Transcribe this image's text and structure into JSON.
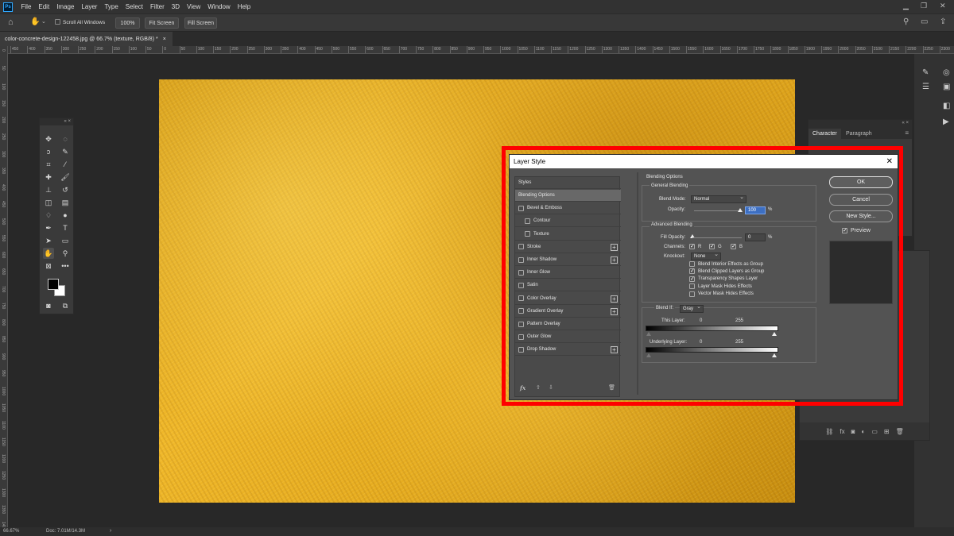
{
  "menubar": {
    "logo": "Ps",
    "items": [
      "File",
      "Edit",
      "Image",
      "Layer",
      "Type",
      "Select",
      "Filter",
      "3D",
      "View",
      "Window",
      "Help"
    ]
  },
  "options": {
    "scroll_all": "Scroll All Windows",
    "zoom": "100%",
    "fit": "Fit Screen",
    "fill": "Fill Screen"
  },
  "document": {
    "tab_title": "color-concrete-design-122458.jpg @ 66.7% (texture, RGB/8) *"
  },
  "ruler": {
    "top": [
      "450",
      "400",
      "350",
      "300",
      "250",
      "200",
      "150",
      "100",
      "50",
      "0",
      "50",
      "100",
      "150",
      "200",
      "250",
      "300",
      "350",
      "400",
      "450",
      "500",
      "550",
      "600",
      "650",
      "700",
      "750",
      "800",
      "850",
      "900",
      "950",
      "1000",
      "1050",
      "1100",
      "1150",
      "1200",
      "1250",
      "1300",
      "1350",
      "1400",
      "1450",
      "1500",
      "1550",
      "1600",
      "1650",
      "1700",
      "1750",
      "1800",
      "1850",
      "1900",
      "1950",
      "2000",
      "2050",
      "2100",
      "2150",
      "2200",
      "2250",
      "2300",
      "235"
    ],
    "left": [
      "0",
      "50",
      "100",
      "150",
      "200",
      "250",
      "300",
      "350",
      "400",
      "450",
      "500",
      "550",
      "600",
      "650",
      "700",
      "750",
      "800",
      "850",
      "900",
      "950",
      "1000",
      "1050",
      "1100",
      "1150",
      "1200",
      "1250",
      "1300",
      "1350",
      "1400"
    ]
  },
  "panels": {
    "character_tab": "Character",
    "paragraph_tab": "Paragraph"
  },
  "status": {
    "zoom": "66.67%",
    "doc": "Doc: 7.01M/14.3M"
  },
  "dialog": {
    "title": "Layer Style",
    "styles_header": "Styles",
    "styles": [
      {
        "label": "Blending Options",
        "checkbox": false,
        "plus": false,
        "indent": false,
        "selected": true
      },
      {
        "label": "Bevel & Emboss",
        "checkbox": true,
        "plus": false,
        "indent": false
      },
      {
        "label": "Contour",
        "checkbox": true,
        "plus": false,
        "indent": true
      },
      {
        "label": "Texture",
        "checkbox": true,
        "plus": false,
        "indent": true
      },
      {
        "label": "Stroke",
        "checkbox": true,
        "plus": true,
        "indent": false
      },
      {
        "label": "Inner Shadow",
        "checkbox": true,
        "plus": true,
        "indent": false
      },
      {
        "label": "Inner Glow",
        "checkbox": true,
        "plus": false,
        "indent": false
      },
      {
        "label": "Satin",
        "checkbox": true,
        "plus": false,
        "indent": false
      },
      {
        "label": "Color Overlay",
        "checkbox": true,
        "plus": true,
        "indent": false
      },
      {
        "label": "Gradient Overlay",
        "checkbox": true,
        "plus": true,
        "indent": false
      },
      {
        "label": "Pattern Overlay",
        "checkbox": true,
        "plus": false,
        "indent": false
      },
      {
        "label": "Outer Glow",
        "checkbox": true,
        "plus": false,
        "indent": false
      },
      {
        "label": "Drop Shadow",
        "checkbox": true,
        "plus": true,
        "indent": false
      }
    ],
    "blending_options": "Blending Options",
    "general_blending": "General Blending",
    "blend_mode_label": "Blend Mode:",
    "blend_mode_value": "Normal",
    "opacity_label": "Opacity:",
    "opacity_value": "100",
    "percent": "%",
    "advanced_blending": "Advanced Blending",
    "fill_opacity_label": "Fill Opacity:",
    "fill_opacity_value": "0",
    "channels_label": "Channels:",
    "channel_r": "R",
    "channel_g": "G",
    "channel_b": "B",
    "knockout_label": "Knockout:",
    "knockout_value": "None",
    "adv_checks": [
      {
        "label": "Blend Interior Effects as Group",
        "checked": false
      },
      {
        "label": "Blend Clipped Layers as Group",
        "checked": true
      },
      {
        "label": "Transparency Shapes Layer",
        "checked": true
      },
      {
        "label": "Layer Mask Hides Effects",
        "checked": false
      },
      {
        "label": "Vector Mask Hides Effects",
        "checked": false
      }
    ],
    "blend_if_label": "Blend If:",
    "blend_if_value": "Gray",
    "this_layer_label": "This Layer:",
    "this_layer_min": "0",
    "this_layer_max": "255",
    "underlying_label": "Underlying Layer:",
    "underlying_min": "0",
    "underlying_max": "255",
    "ok": "OK",
    "cancel": "Cancel",
    "new_style": "New Style...",
    "preview": "Preview",
    "fx": "fx"
  }
}
